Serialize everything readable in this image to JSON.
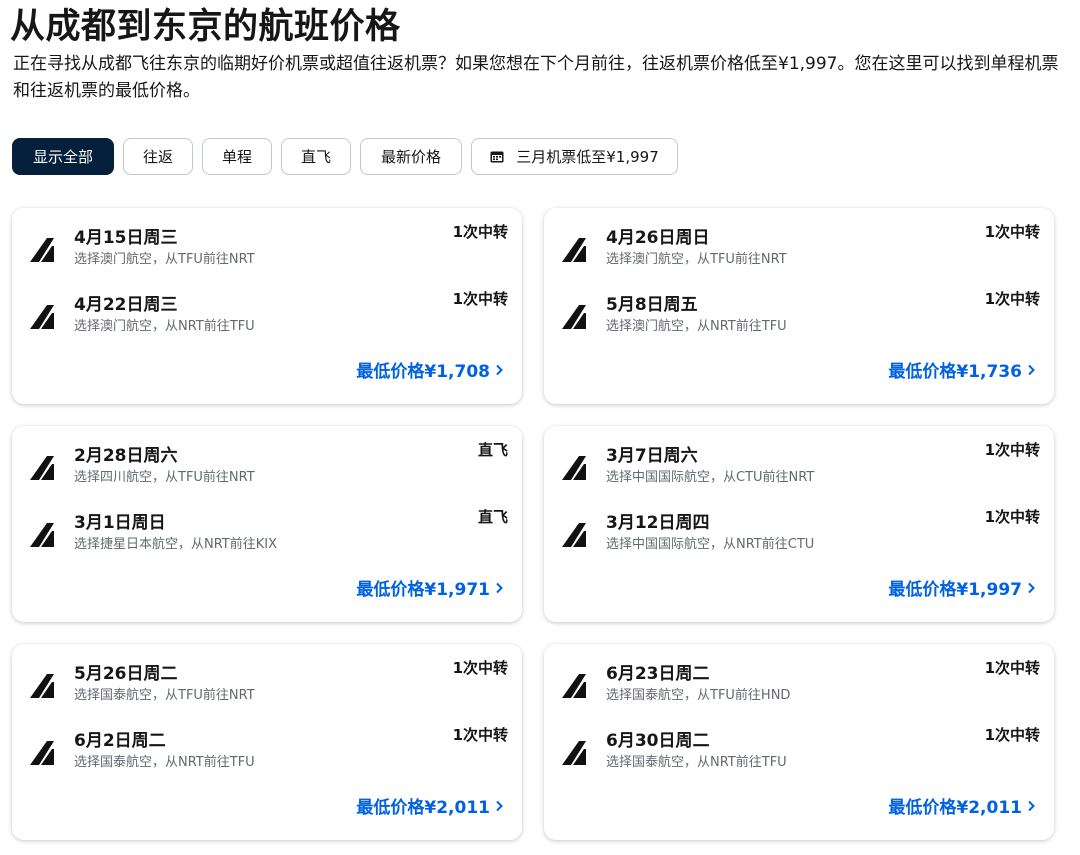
{
  "page": {
    "title": "从成都到东京的航班价格",
    "intro": "正在寻找从成都飞往东京的临期好价机票或超值往返机票？如果您想在下个月前往，往返机票价格低至¥1,997。您在这里可以找到单程机票和往返机票的最低价格。"
  },
  "filters": [
    {
      "label": "显示全部",
      "active": true
    },
    {
      "label": "往返",
      "active": false
    },
    {
      "label": "单程",
      "active": false
    },
    {
      "label": "直飞",
      "active": false
    },
    {
      "label": "最新价格",
      "active": false
    },
    {
      "label": "三月机票低至¥1,997",
      "active": false,
      "icon": "calendar-icon"
    }
  ],
  "cards": [
    {
      "legs": [
        {
          "date": "4月15日周三",
          "airline": "选择澳门航空，从TFU前往NRT",
          "stops": "1次中转"
        },
        {
          "date": "4月22日周三",
          "airline": "选择澳门航空，从NRT前往TFU",
          "stops": "1次中转"
        }
      ],
      "price": "最低价格¥1,708"
    },
    {
      "legs": [
        {
          "date": "4月26日周日",
          "airline": "选择澳门航空，从TFU前往NRT",
          "stops": "1次中转"
        },
        {
          "date": "5月8日周五",
          "airline": "选择澳门航空，从NRT前往TFU",
          "stops": "1次中转"
        }
      ],
      "price": "最低价格¥1,736"
    },
    {
      "legs": [
        {
          "date": "2月28日周六",
          "airline": "选择四川航空，从TFU前往NRT",
          "stops": "直飞"
        },
        {
          "date": "3月1日周日",
          "airline": "选择捷星日本航空，从NRT前往KIX",
          "stops": "直飞"
        }
      ],
      "price": "最低价格¥1,971"
    },
    {
      "legs": [
        {
          "date": "3月7日周六",
          "airline": "选择中国国际航空，从CTU前往NRT",
          "stops": "1次中转"
        },
        {
          "date": "3月12日周四",
          "airline": "选择中国国际航空，从NRT前往CTU",
          "stops": "1次中转"
        }
      ],
      "price": "最低价格¥1,997"
    },
    {
      "legs": [
        {
          "date": "5月26日周二",
          "airline": "选择国泰航空，从TFU前往NRT",
          "stops": "1次中转"
        },
        {
          "date": "6月2日周二",
          "airline": "选择国泰航空，从NRT前往TFU",
          "stops": "1次中转"
        }
      ],
      "price": "最低价格¥2,011"
    },
    {
      "legs": [
        {
          "date": "6月23日周二",
          "airline": "选择国泰航空，从TFU前往HND",
          "stops": "1次中转"
        },
        {
          "date": "6月30日周二",
          "airline": "选择国泰航空，从NRT前往TFU",
          "stops": "1次中转"
        }
      ],
      "price": "最低价格¥2,011"
    }
  ],
  "colors": {
    "primary_dark": "#05203c",
    "link": "#0062e3",
    "muted": "#626971",
    "border": "#c1c7cf"
  },
  "icons": {
    "airline_logo": "airline-tail-icon",
    "price_chevron": "chevron-right-icon"
  }
}
